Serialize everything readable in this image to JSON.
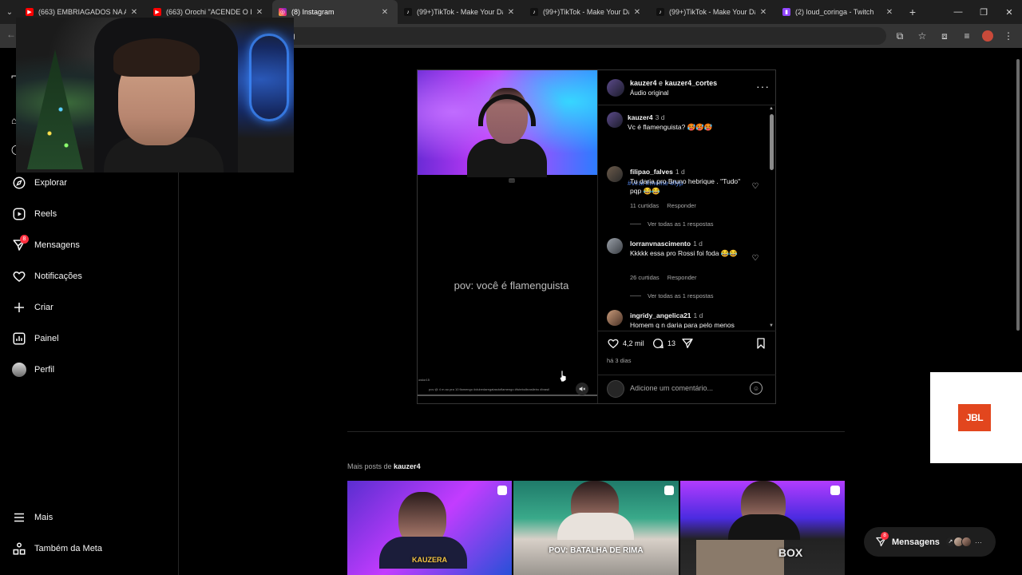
{
  "browser": {
    "tabs": [
      {
        "label": "(663) EMBRIAGADOS NA ACAD",
        "icon": "youtube-icon",
        "active": false
      },
      {
        "label": "(663) Orochi \"ACENDE O ISQU",
        "icon": "youtube-icon",
        "active": false
      },
      {
        "label": "(8) Instagram",
        "icon": "instagram-icon",
        "active": true
      },
      {
        "label": "(99+)TikTok - Make Your Day",
        "icon": "tiktok-icon",
        "active": false
      },
      {
        "label": "(99+)TikTok - Make Your Day",
        "icon": "tiktok-icon",
        "active": false
      },
      {
        "label": "(99+)TikTok - Make Your Day",
        "icon": "tiktok-icon",
        "active": false
      },
      {
        "label": "(2) loud_coringa - Twitch",
        "icon": "twitch-icon",
        "active": false
      }
    ],
    "omnibox_partial": "g"
  },
  "sidebar": {
    "items": [
      {
        "label": "Explorar",
        "icon": "compass-icon"
      },
      {
        "label": "Reels",
        "icon": "reels-icon"
      },
      {
        "label": "Mensagens",
        "icon": "messenger-icon",
        "badge": "8"
      },
      {
        "label": "Notificações",
        "icon": "heart-icon"
      },
      {
        "label": "Criar",
        "icon": "plus-icon"
      },
      {
        "label": "Painel",
        "icon": "dashboard-icon"
      },
      {
        "label": "Perfil",
        "icon": "profile-avatar-icon"
      }
    ],
    "bottom": [
      {
        "label": "Mais",
        "icon": "menu-icon"
      },
      {
        "label": "Também da Meta",
        "icon": "meta-icon"
      }
    ]
  },
  "post": {
    "video": {
      "caption": "pov: você é flamenguista",
      "credit": "owlor15",
      "hashtags_small": "pov @ 4 m ao pra 10 flamengo #clubedaregatasdoflamengo #futebolbrasileiro #brasil"
    },
    "header": {
      "user": "kauzer4",
      "joiner": "e",
      "collab": "kauzer4_cortes",
      "audio": "Áudio original"
    },
    "caption": {
      "user": "kauzer4",
      "when": "3 d",
      "text": "Vc é flamenguista? 🥵🥵🥵",
      "hashtags": "#viral #meme #fyp"
    },
    "comments": [
      {
        "user": "filipao_falves",
        "when": "1 d",
        "text": "Tu daria pro Bruno hebrique . \"Tudo\" pqp 😂😂",
        "likes": "11 curtidas",
        "reply": "Responder",
        "view_replies": "Ver todas as 1 respostas"
      },
      {
        "user": "lorranvnascimento",
        "when": "1 d",
        "text": "Kkkkk essa pro Rossi foi foda 😂😂",
        "likes": "26 curtidas",
        "reply": "Responder",
        "view_replies": "Ver todas as 1 respostas"
      },
      {
        "user": "ingridy_angelica21",
        "when": "1 d",
        "text": "Homem q n daria para pelo menos"
      }
    ],
    "likes": "4,2 mil",
    "comments_count": "13",
    "date": "há 3 dias",
    "add_comment_placeholder": "Adicione um comentário..."
  },
  "more_posts": {
    "prefix": "Mais posts de",
    "user": "kauzer4",
    "thumbs": [
      {
        "label": "KAUZERA"
      },
      {
        "label": "POV: BATALHA DE RIMA"
      },
      {
        "label": "BOX"
      }
    ]
  },
  "ad": {
    "logo": "JBL"
  },
  "messages_pill": {
    "label": "Mensagens",
    "badge": "8"
  },
  "colors": {
    "background": "#000000",
    "link_blue": "#4f7fe0",
    "badge_red": "#ff3040",
    "jbl_orange": "#e2461e"
  }
}
